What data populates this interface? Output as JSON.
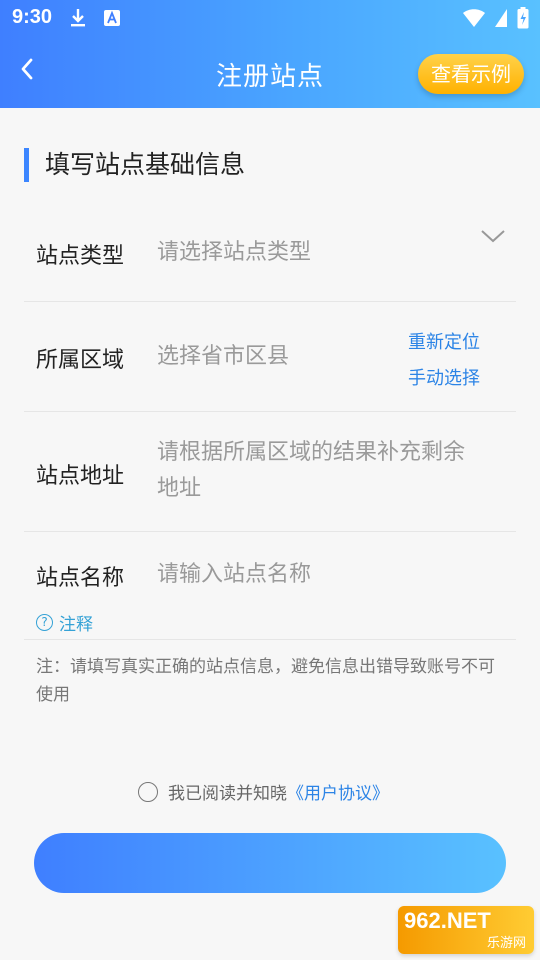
{
  "status_bar": {
    "time": "9:30",
    "icons": [
      "download-icon",
      "a-icon",
      "wifi-icon",
      "battery-icon"
    ]
  },
  "nav": {
    "title": "注册站点",
    "example_button": "查看示例"
  },
  "section_title": "填写站点基础信息",
  "form": {
    "type": {
      "label": "站点类型",
      "placeholder": "请选择站点类型"
    },
    "region": {
      "label": "所属区域",
      "placeholder": "选择省市区县",
      "relocate": "重新定位",
      "manual": "手动选择"
    },
    "address": {
      "label": "站点地址",
      "placeholder_line1": "请根据所属区域的结果补充剩余",
      "placeholder_line2": "地址"
    },
    "name": {
      "label": "站点名称",
      "placeholder": "请输入站点名称",
      "note": "注释"
    }
  },
  "tip": "注：请填写真实正确的站点信息，避免信息出错导致账号不可使用",
  "agreement": {
    "text": "我已阅读并知晓",
    "link": "《用户协议》"
  },
  "watermark": {
    "big": "962.NET",
    "small": "乐游网"
  },
  "colors": {
    "primary": "#3f7fff",
    "accent": "#ffb100",
    "link": "#2c84e6"
  }
}
